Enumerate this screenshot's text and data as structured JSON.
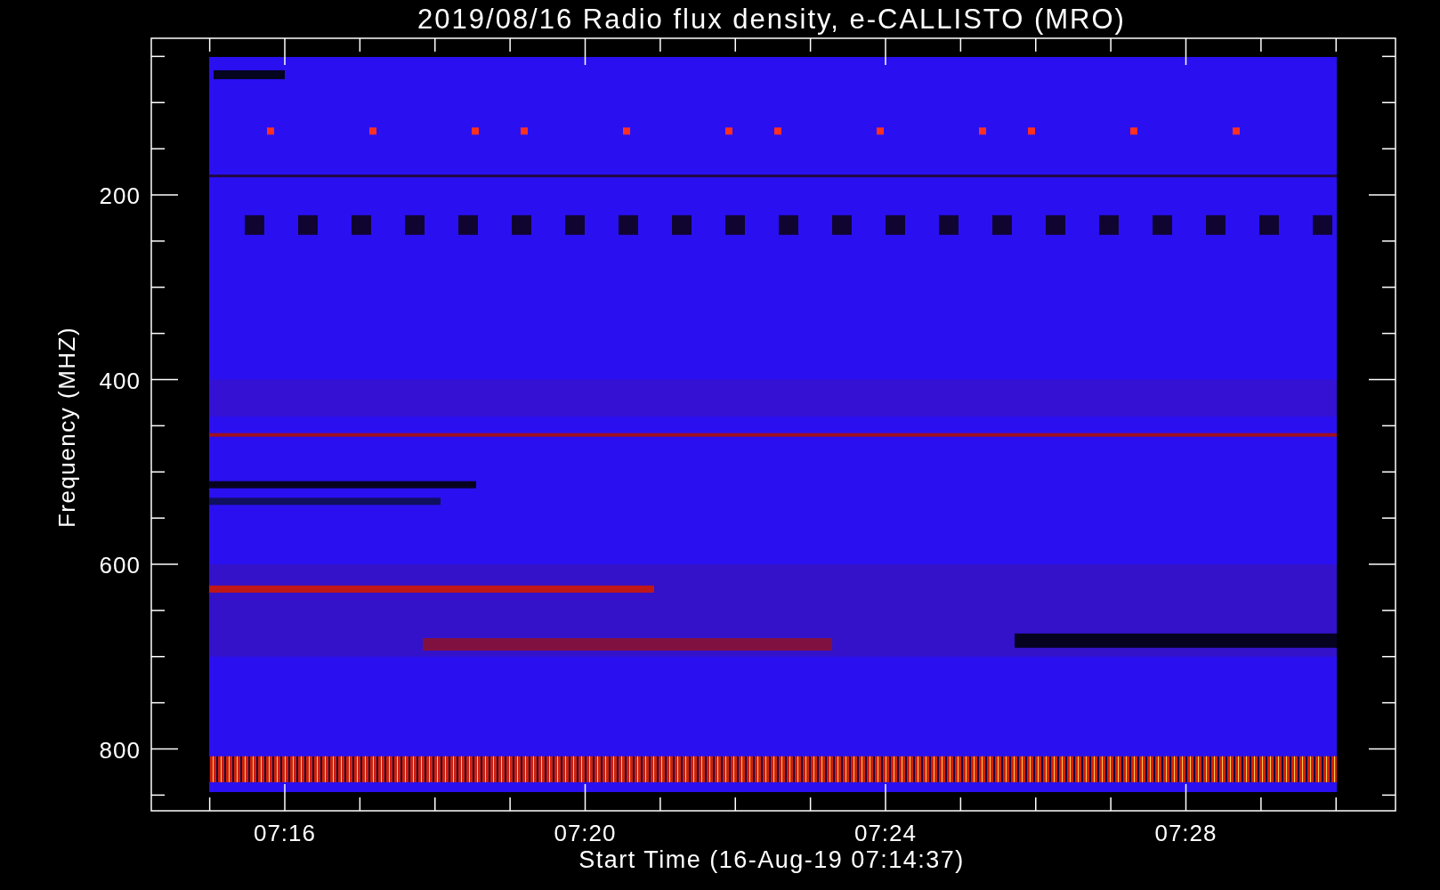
{
  "title": "2019/08/16  Radio flux density, e-CALLISTO (MRO)",
  "y_axis": {
    "label": "Frequency (MHZ)",
    "ticks": [
      "200",
      "400",
      "600",
      "800"
    ]
  },
  "x_axis": {
    "label": "Start Time (16-Aug-19 07:14:37)",
    "ticks": [
      "07:16",
      "07:20",
      "07:24",
      "07:28"
    ]
  }
}
